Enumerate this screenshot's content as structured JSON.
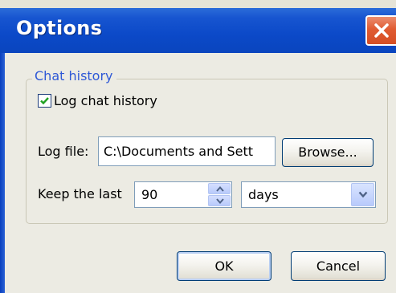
{
  "window": {
    "title": "Options"
  },
  "group": {
    "legend": "Chat history"
  },
  "log_checkbox": {
    "label": "Log chat history",
    "checked": true
  },
  "log_file": {
    "label": "Log file:",
    "value": "C:\\Documents and Sett",
    "browse_label": "Browse..."
  },
  "keep": {
    "label": "Keep the last",
    "value": "90",
    "unit_selected": "days"
  },
  "buttons": {
    "ok_label": "OK",
    "cancel_label": "Cancel"
  },
  "icons": {
    "close": "close-icon",
    "check": "checkmark-icon",
    "spin_up": "arrow-up-icon",
    "spin_down": "arrow-down-icon",
    "dropdown": "chevron-down-icon"
  },
  "colors": {
    "titlebar": "#0b49c8",
    "close_button": "#e05b32",
    "legend_text": "#2f59d6",
    "dialog_bg": "#ecebe3"
  }
}
